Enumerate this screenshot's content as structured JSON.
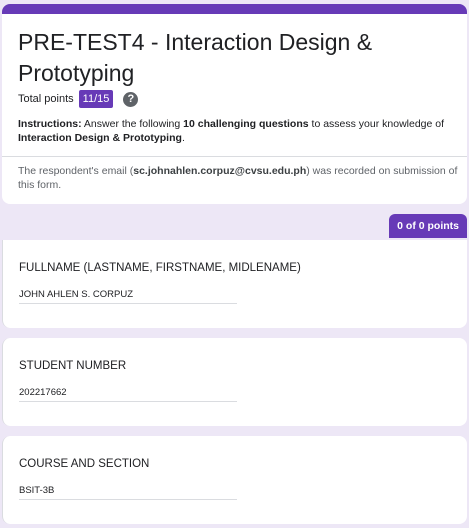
{
  "header": {
    "title": "PRE-TEST4 - Interaction Design & Prototyping",
    "total_points_label": "Total points",
    "score": "11/15",
    "instructions_label": "Instructions:",
    "instructions_pre": " Answer the following ",
    "instructions_bold": "10 challenging questions",
    "instructions_post": " to assess your knowledge of ",
    "instructions_topic": "Interaction Design & Prototyping",
    "instructions_end": ".",
    "email_pre": "The respondent's email (",
    "email": "sc.johnahlen.corpuz@cvsu.edu.ph",
    "email_post": ") was recorded on submission of this form."
  },
  "section": {
    "points": "0 of 0 points"
  },
  "questions": [
    {
      "label": "FULLNAME (LASTNAME, FIRSTNAME, MIDLENAME)",
      "answer": "JOHN AHLEN S. CORPUZ"
    },
    {
      "label": "STUDENT NUMBER",
      "answer": "202217662"
    },
    {
      "label": "COURSE AND SECTION",
      "answer": "BSIT-3B"
    }
  ],
  "colors": {
    "accent": "#673ab7",
    "background": "#ede7f6"
  }
}
